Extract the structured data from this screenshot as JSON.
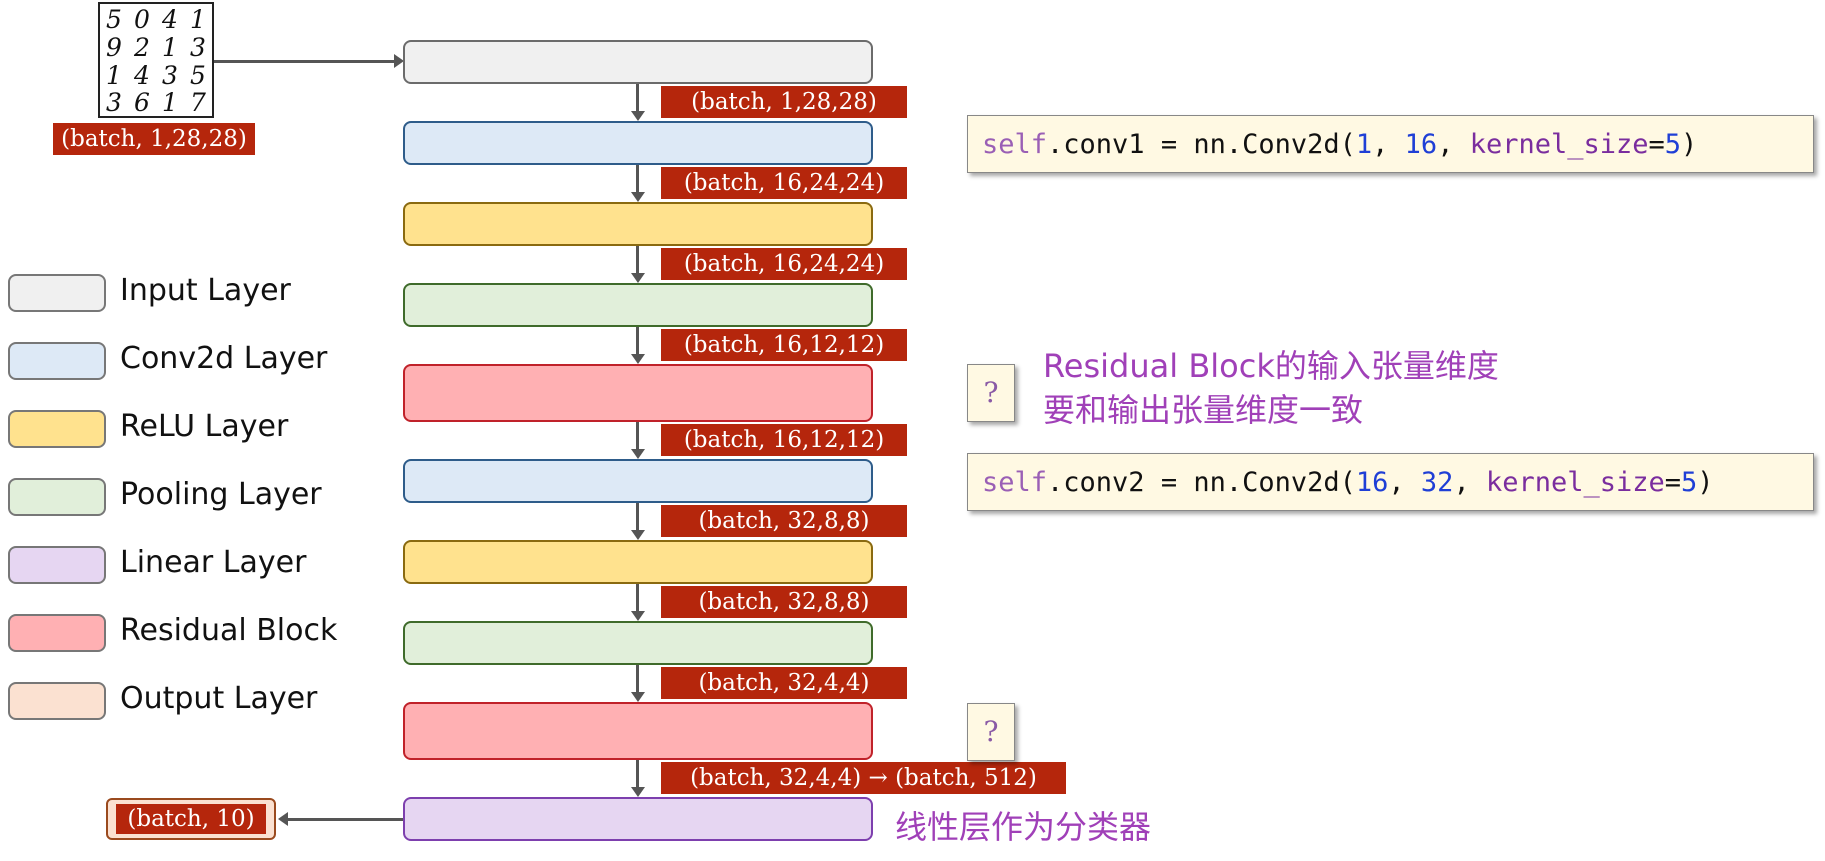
{
  "mnist": {
    "rows": [
      [
        "5",
        "0",
        "4",
        "1"
      ],
      [
        "9",
        "2",
        "1",
        "3"
      ],
      [
        "1",
        "4",
        "3",
        "5"
      ],
      [
        "3",
        "6",
        "1",
        "7"
      ]
    ],
    "shape_label": "(batch, 1,28,28)"
  },
  "shapes": [
    "(batch, 1,28,28)",
    "(batch, 16,24,24)",
    "(batch, 16,24,24)",
    "(batch, 16,12,12)",
    "(batch, 16,12,12)",
    "(batch, 32,8,8)",
    "(batch, 32,8,8)",
    "(batch, 32,4,4)",
    "(batch, 32,4,4) → (batch, 512)"
  ],
  "output_shape": "(batch, 10)",
  "legend": [
    {
      "label": "Input Layer"
    },
    {
      "label": "Conv2d Layer"
    },
    {
      "label": "ReLU Layer"
    },
    {
      "label": "Pooling Layer"
    },
    {
      "label": "Linear Layer"
    },
    {
      "label": "Residual Block"
    },
    {
      "label": "Output Layer"
    }
  ],
  "code1": {
    "self": "self",
    "rest": ".conv1 = nn.Conv2d(",
    "a": "1",
    "sep1": ", ",
    "b": "16",
    "sep2": ", ",
    "kw": "kernel_size",
    "eq": "=",
    "k": "5",
    "end": ")"
  },
  "code2": {
    "self": "self",
    "rest": ".conv2 = nn.Conv2d(",
    "a": "16",
    "sep1": ", ",
    "b": "32",
    "sep2": ", ",
    "kw": "kernel_size",
    "eq": "=",
    "k": "5",
    "end": ")"
  },
  "question_mark": "?",
  "note_residual": [
    "Residual Block的输入张量维度",
    "要和输出张量维度一致"
  ],
  "note_linear": "线性层作为分类器",
  "colors": {
    "shape_bg": "#b5260c",
    "note_purple": "#a040b8",
    "input": "#f0f0f0",
    "conv": "#dde9f6",
    "relu": "#ffe28e",
    "pool": "#e1efda",
    "residual": "#ffb0b3",
    "linear": "#e6d6f2",
    "output": "#fbe1d1"
  }
}
